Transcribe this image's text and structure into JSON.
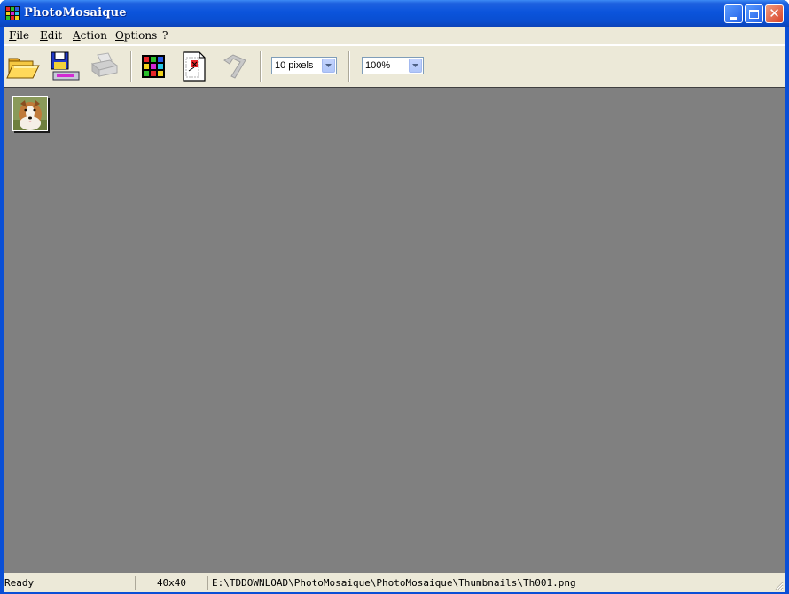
{
  "window": {
    "title": "PhotoMosaique"
  },
  "menu": {
    "items": [
      {
        "label": "File",
        "mnemonic": "F",
        "rest": "ile"
      },
      {
        "label": "Edit",
        "mnemonic": "E",
        "rest": "dit"
      },
      {
        "label": "Action",
        "mnemonic": "A",
        "rest": "ction"
      },
      {
        "label": "Options",
        "mnemonic": "O",
        "rest": "ptions"
      },
      {
        "label": "?",
        "mnemonic": "",
        "rest": "?"
      }
    ]
  },
  "toolbar": {
    "buttons": [
      {
        "icon": "open-folder-icon",
        "enabled": true
      },
      {
        "icon": "save-disk-icon",
        "enabled": true
      },
      {
        "icon": "printer-icon",
        "enabled": false
      },
      {
        "icon": "mosaic-grid-icon",
        "enabled": true
      },
      {
        "icon": "document-page-icon",
        "enabled": true
      },
      {
        "icon": "undo-arrow-icon",
        "enabled": false
      }
    ],
    "pixel_size": {
      "value": "10 pixels"
    },
    "zoom": {
      "value": "100%"
    }
  },
  "canvas": {
    "background": "#808080",
    "thumbnail": {
      "subject": "collie-dog-photo"
    }
  },
  "statusbar": {
    "state": "Ready",
    "dimensions": "40x40",
    "path": "E:\\TDDOWNLOAD\\PhotoMosaique\\PhotoMosaique\\Thumbnails\\Th001.png"
  },
  "colors": {
    "titlebar": "#0a4fd6",
    "chrome": "#ece9d8",
    "canvas": "#808080"
  }
}
